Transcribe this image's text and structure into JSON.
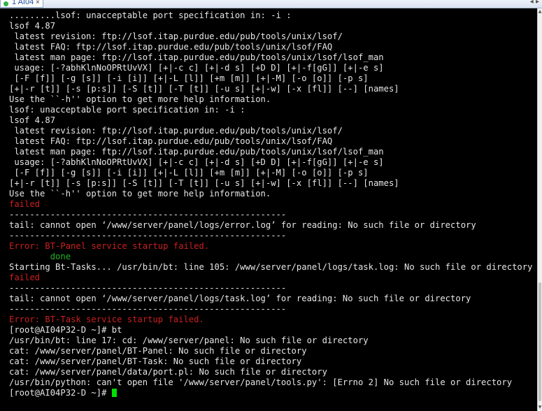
{
  "window": {
    "tab_label": "1 AI04",
    "tab_close": "×",
    "nav_arrows": "◂ ▸"
  },
  "colors": {
    "background": "#000000",
    "text": "#e6e6e6",
    "error": "#cc1f1f",
    "success": "#22b324",
    "cursor": "#00e000"
  },
  "terminal": {
    "lines": [
      {
        "text": ".........lsof: unacceptable port specification in: -i :",
        "color": "default"
      },
      {
        "text": "lsof 4.87",
        "color": "default"
      },
      {
        "text": " latest revision: ftp://lsof.itap.purdue.edu/pub/tools/unix/lsof/",
        "color": "default"
      },
      {
        "text": " latest FAQ: ftp://lsof.itap.purdue.edu/pub/tools/unix/lsof/FAQ",
        "color": "default"
      },
      {
        "text": " latest man page: ftp://lsof.itap.purdue.edu/pub/tools/unix/lsof/lsof_man",
        "color": "default"
      },
      {
        "text": " usage: [-?abhKlnNoOPRtUvVX] [+|-c c] [+|-d s] [+D D] [+|-f[gG]] [+|-e s]",
        "color": "default"
      },
      {
        "text": " [-F [f]] [-g [s]] [-i [i]] [+|-L [l]] [+m [m]] [+|-M] [-o [o]] [-p s]",
        "color": "default"
      },
      {
        "text": "[+|-r [t]] [-s [p:s]] [-S [t]] [-T [t]] [-u s] [+|-w] [-x [fl]] [--] [names]",
        "color": "default"
      },
      {
        "text": "Use the ``-h'' option to get more help information.",
        "color": "default"
      },
      {
        "text": "lsof: unacceptable port specification in: -i :",
        "color": "default"
      },
      {
        "text": "lsof 4.87",
        "color": "default"
      },
      {
        "text": " latest revision: ftp://lsof.itap.purdue.edu/pub/tools/unix/lsof/",
        "color": "default"
      },
      {
        "text": " latest FAQ: ftp://lsof.itap.purdue.edu/pub/tools/unix/lsof/FAQ",
        "color": "default"
      },
      {
        "text": " latest man page: ftp://lsof.itap.purdue.edu/pub/tools/unix/lsof/lsof_man",
        "color": "default"
      },
      {
        "text": " usage: [-?abhKlnNoOPRtUvVX] [+|-c c] [+|-d s] [+D D] [+|-f[gG]] [+|-e s]",
        "color": "default"
      },
      {
        "text": " [-F [f]] [-g [s]] [-i [i]] [+|-L [l]] [+m [m]] [+|-M] [-o [o]] [-p s]",
        "color": "default"
      },
      {
        "text": "[+|-r [t]] [-s [p:s]] [-S [t]] [-T [t]] [-u s] [+|-w] [-x [fl]] [--] [names]",
        "color": "default"
      },
      {
        "text": "Use the ``-h'' option to get more help information.",
        "color": "default"
      },
      {
        "text": "failed",
        "color": "red"
      },
      {
        "text": "------------------------------------------------------",
        "color": "default"
      },
      {
        "text": "tail: cannot open ‘/www/server/panel/logs/error.log’ for reading: No such file or directory",
        "color": "default"
      },
      {
        "text": "------------------------------------------------------",
        "color": "default"
      },
      {
        "text": "Error: BT-Panel service startup failed.",
        "color": "red"
      },
      {
        "text": "        done",
        "color": "green"
      },
      {
        "text": "Starting Bt-Tasks... /usr/bin/bt: line 105: /www/server/panel/logs/task.log: No such file or directory",
        "color": "default"
      },
      {
        "text": "failed",
        "color": "red"
      },
      {
        "text": "------------------------------------------------------",
        "color": "default"
      },
      {
        "text": "tail: cannot open ‘/www/server/panel/logs/task.log’ for reading: No such file or directory",
        "color": "default"
      },
      {
        "text": "------------------------------------------------------",
        "color": "default"
      },
      {
        "text": "Error: BT-Task service startup failed.",
        "color": "red"
      },
      {
        "text": "[root@AI04P32-D ~]# bt",
        "color": "default"
      },
      {
        "text": "/usr/bin/bt: line 17: cd: /www/server/panel: No such file or directory",
        "color": "default"
      },
      {
        "text": "cat: /www/server/panel/BT-Panel: No such file or directory",
        "color": "default"
      },
      {
        "text": "cat: /www/server/panel/BT-Task: No such file or directory",
        "color": "default"
      },
      {
        "text": "cat: /www/server/panel/data/port.pl: No such file or directory",
        "color": "default"
      },
      {
        "text": "/usr/bin/python: can't open file '/www/server/panel/tools.py': [Errno 2] No such file or directory",
        "color": "default"
      }
    ],
    "prompt": "[root@AI04P32-D ~]# "
  }
}
